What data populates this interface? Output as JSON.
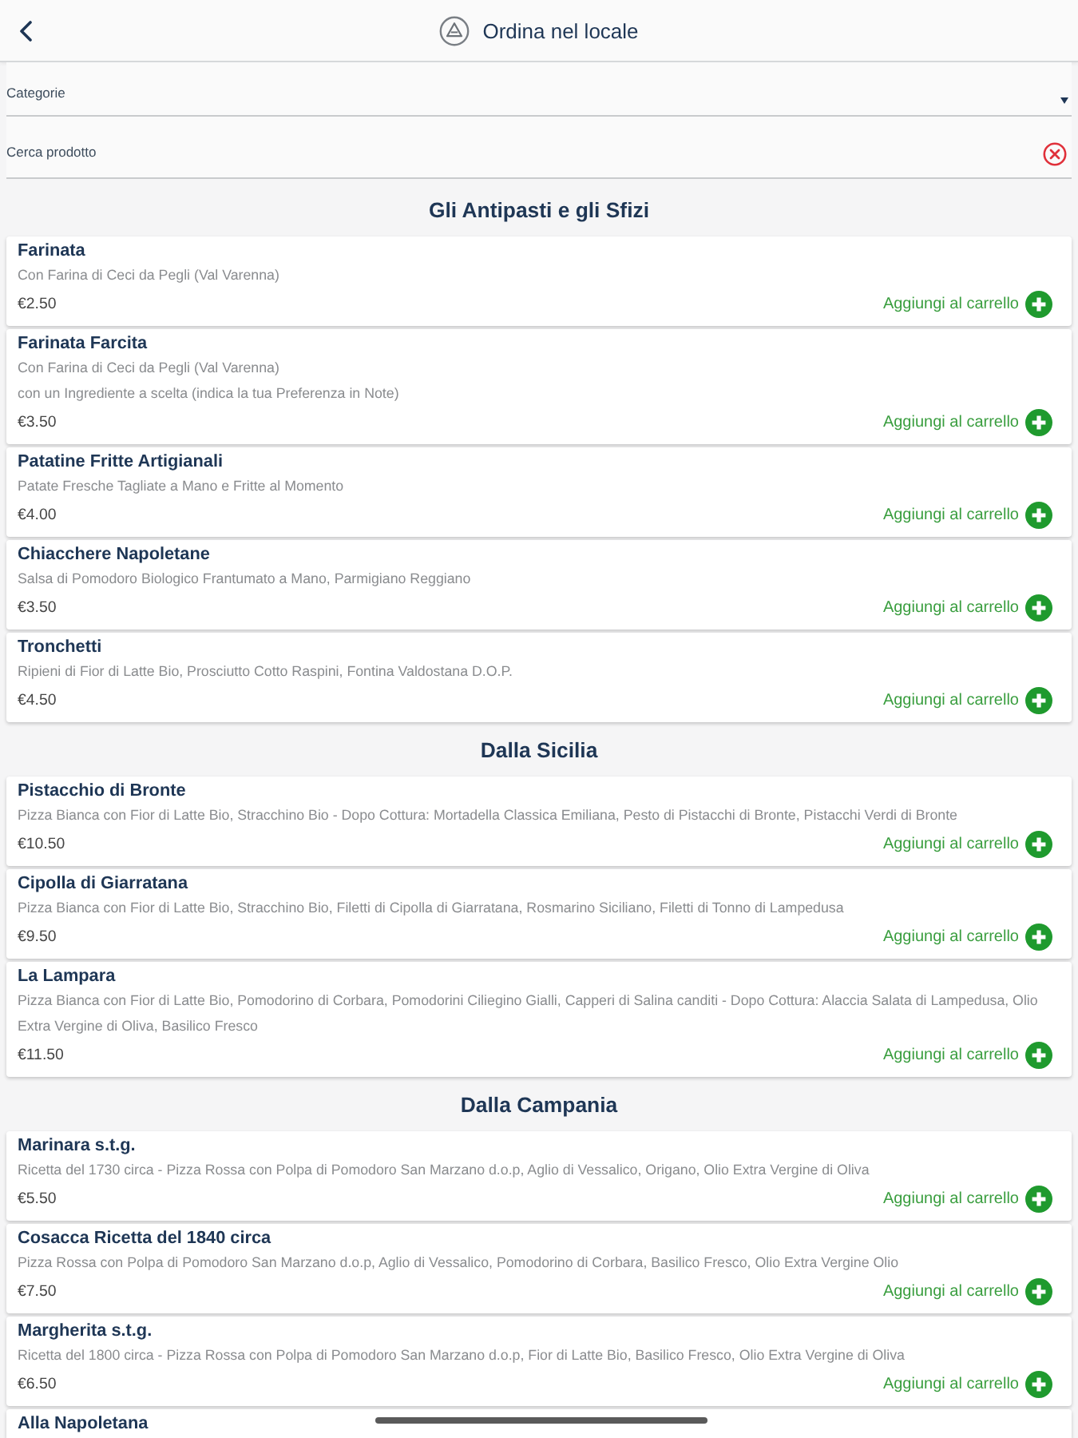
{
  "header": {
    "title": "Ordina nel locale"
  },
  "filters": {
    "category": {
      "placeholder": "Categorie"
    },
    "search": {
      "placeholder": "Cerca prodotto"
    }
  },
  "sections": [
    {
      "title": "Gli Antipasti e gli Sfizi",
      "products": [
        {
          "name": "Farinata",
          "description": [
            "Con Farina di Ceci da Pegli (Val Varenna)"
          ],
          "price": "€2.50",
          "add_label": "Aggiungi al carrello"
        },
        {
          "name": "Farinata Farcita",
          "description": [
            "Con Farina di Ceci da Pegli (Val Varenna)",
            "con un Ingrediente a scelta (indica la tua Preferenza in Note)"
          ],
          "price": "€3.50",
          "add_label": "Aggiungi al carrello"
        },
        {
          "name": "Patatine Fritte Artigianali",
          "description": [
            "Patate Fresche Tagliate a Mano e Fritte al Momento"
          ],
          "price": "€4.00",
          "add_label": "Aggiungi al carrello"
        },
        {
          "name": "Chiacchere Napoletane",
          "description": [
            "Salsa di Pomodoro Biologico Frantumato a Mano, Parmigiano Reggiano"
          ],
          "price": "€3.50",
          "add_label": "Aggiungi al carrello"
        },
        {
          "name": "Tronchetti",
          "description": [
            "Ripieni di Fior di Latte Bio, Prosciutto Cotto Raspini, Fontina Valdostana D.O.P."
          ],
          "price": "€4.50",
          "add_label": "Aggiungi al carrello"
        }
      ]
    },
    {
      "title": "Dalla Sicilia",
      "products": [
        {
          "name": "Pistacchio di Bronte",
          "description": [
            "Pizza Bianca con Fior di Latte Bio, Stracchino Bio - Dopo Cottura: Mortadella Classica Emiliana, Pesto di Pistacchi di Bronte, Pistacchi Verdi di Bronte"
          ],
          "price": "€10.50",
          "add_label": "Aggiungi al carrello"
        },
        {
          "name": "Cipolla di Giarratana",
          "description": [
            "Pizza Bianca con Fior di Latte Bio, Stracchino Bio, Filetti di Cipolla di Giarratana, Rosmarino Siciliano, Filetti di Tonno di Lampedusa"
          ],
          "price": "€9.50",
          "add_label": "Aggiungi al carrello"
        },
        {
          "name": "La Lampara",
          "description": [
            "Pizza Bianca con Fior di Latte Bio, Pomodorino di Corbara, Pomodorini Ciliegino Gialli, Capperi di Salina canditi - Dopo Cottura: Alaccia Salata di Lampedusa, Olio Extra Vergine di Oliva, Basilico Fresco"
          ],
          "price": "€11.50",
          "add_label": "Aggiungi al carrello"
        }
      ]
    },
    {
      "title": "Dalla Campania",
      "products": [
        {
          "name": "Marinara s.t.g.",
          "description": [
            "Ricetta del 1730 circa - Pizza Rossa con Polpa di Pomodoro San Marzano d.o.p, Aglio di Vessalico, Origano, Olio Extra Vergine di Oliva"
          ],
          "price": "€5.50",
          "add_label": "Aggiungi al carrello"
        },
        {
          "name": "Cosacca Ricetta del 1840 circa",
          "description": [
            "Pizza Rossa con Polpa di Pomodoro San Marzano d.o.p, Aglio di Vessalico, Pomodorino di Corbara, Basilico Fresco, Olio Extra Vergine Olio"
          ],
          "price": "€7.50",
          "add_label": "Aggiungi al carrello"
        },
        {
          "name": "Margherita s.t.g.",
          "description": [
            "Ricetta del 1800 circa - Pizza Rossa con Polpa di Pomodoro San Marzano d.o.p, Fior di Latte Bio, Basilico Fresco, Olio Extra Vergine di Oliva"
          ],
          "price": "€6.50",
          "add_label": "Aggiungi al carrello"
        },
        {
          "name": "Alla Napoletana"
        }
      ]
    }
  ]
}
